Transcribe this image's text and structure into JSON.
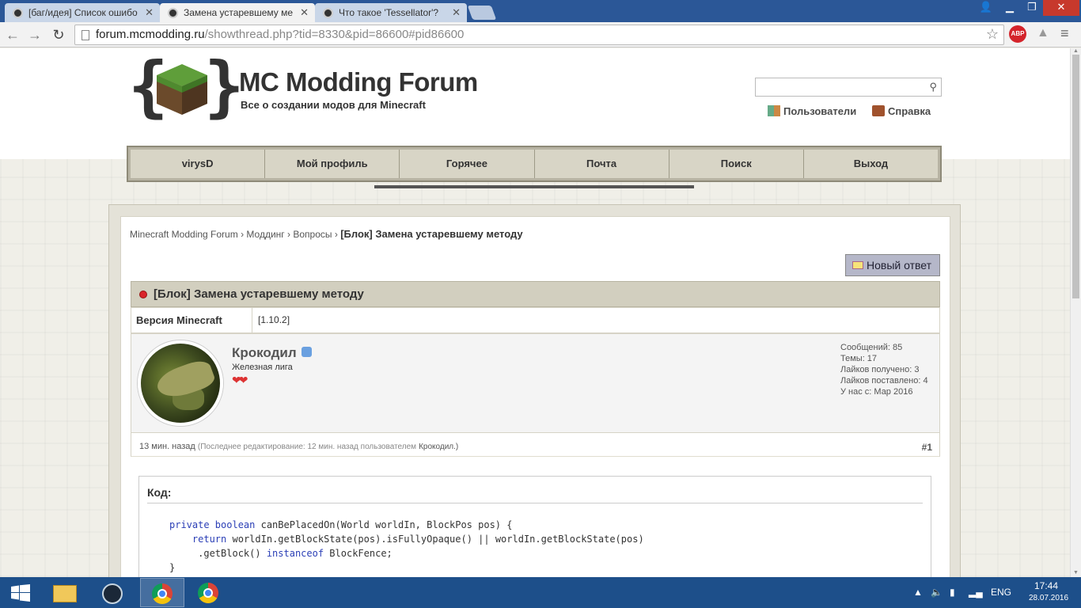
{
  "browser": {
    "tabs": [
      {
        "title": "[баг/идея] Список ошибо"
      },
      {
        "title": "Замена устаревшему ме"
      },
      {
        "title": "Что такое 'Tessellator'?"
      }
    ],
    "url_host": "forum.mcmodding.ru",
    "url_path": "/showthread.php?tid=8330&pid=86600#pid86600",
    "abp_label": "ABP"
  },
  "site": {
    "title": "MC Modding Forum",
    "subtitle": "Все о создании модов для Minecraft",
    "links": {
      "users": "Пользователи",
      "help": "Справка"
    }
  },
  "nav": {
    "items": [
      "virysD",
      "Мой профиль",
      "Горячее",
      "Почта",
      "Поиск",
      "Выход"
    ]
  },
  "breadcrumb": {
    "items": [
      "Minecraft Modding Forum",
      "Моддинг",
      "Вопросы"
    ],
    "current": "[Блок] Замена устаревшему методу",
    "separator": "›"
  },
  "new_reply_label": "Новый ответ",
  "thread": {
    "title": "[Блок] Замена устаревшему методу",
    "prefix_label": "Версия Minecraft",
    "prefix_value": "[1.10.2]"
  },
  "post": {
    "author": "Крокодил",
    "user_title": "Железная лига",
    "hearts": "❤❤",
    "stats": [
      "Сообщений: 85",
      "Темы: 17",
      "Лайков получено: 3",
      "Лайков поставлено: 4",
      "У нас с: Мар 2016"
    ],
    "time": "13 мин. назад",
    "edit_note": "(Последнее редактирование: 12 мин. назад пользователем",
    "edit_user": "Крокодил.)",
    "number": "#1",
    "code_title": "Код:",
    "code": {
      "l1_kw": "private boolean",
      "l1_rest": " canBePlacedOn(World worldIn, BlockPos pos) {",
      "l2_kw": "return",
      "l2_rest": " worldIn.getBlockState(pos).isFullyOpaque() || worldIn.getBlockState(pos)",
      "l3_pre": ".getBlock() ",
      "l3_kw": "instanceof",
      "l3_rest": " BlockFence;",
      "l4": "}"
    }
  },
  "taskbar": {
    "lang": "ENG",
    "time": "17:44",
    "date": "28.07.2016"
  },
  "colors": {
    "taskbar": "#1d4f8a",
    "tabbar": "#2b5797",
    "online_dot": "#d9252a"
  }
}
